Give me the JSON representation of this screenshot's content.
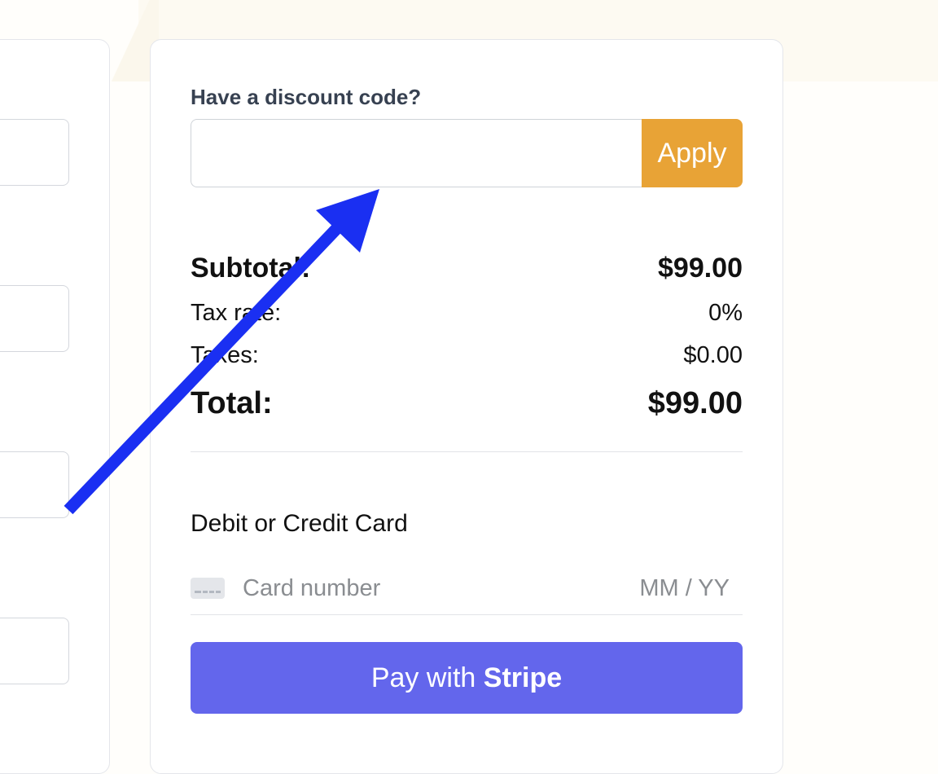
{
  "discount": {
    "label": "Have a discount code?",
    "input_value": "",
    "placeholder": "",
    "apply_label": "Apply"
  },
  "summary": {
    "subtotal_label": "Subtotal:",
    "subtotal_value": "$99.00",
    "tax_rate_label": "Tax rate:",
    "tax_rate_value": "0%",
    "taxes_label": "Taxes:",
    "taxes_value": "$0.00",
    "total_label": "Total:",
    "total_value": "$99.00"
  },
  "payment": {
    "section_label": "Debit or Credit Card",
    "card_number_placeholder": "Card number",
    "expiry_placeholder": "MM / YY",
    "pay_prefix": "Pay with",
    "pay_brand": "Stripe"
  },
  "annotation": {
    "icon": "arrow-annotation-icon"
  },
  "colors": {
    "apply_button": "#e8a336",
    "pay_button": "#6366ec",
    "annotation_arrow": "#1a2ff2"
  }
}
